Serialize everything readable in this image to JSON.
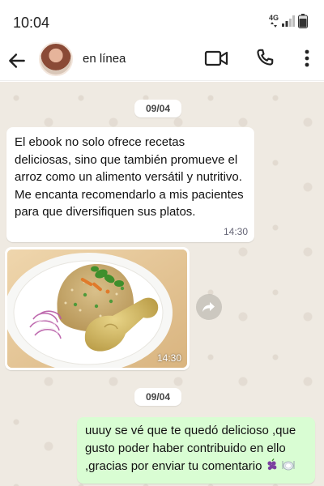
{
  "status_bar": {
    "time": "10:04",
    "network": "4G"
  },
  "header": {
    "contact_status": "en línea"
  },
  "chat": {
    "date_chips": [
      "09/04",
      "09/04"
    ],
    "incoming_message": {
      "text": "El ebook no solo ofrece recetas deliciosas, sino que también promueve el arroz como un alimento versátil y nutritivo. Me encanta recomendarlo a mis pacientes para que diversifiquen sus platos.",
      "time": "14:30"
    },
    "image_message": {
      "time": "14:30"
    },
    "outgoing_message": {
      "text": "uuuy se vé que te quedó delicioso ,que gusto poder haber contribuido en ello ,gracias por enviar tu comentario"
    }
  },
  "colors": {
    "chat_background": "#efeae2",
    "outgoing_bubble": "#d9fdd3",
    "incoming_bubble": "#ffffff"
  },
  "icons": {
    "back": "arrow-left-icon",
    "video": "video-call-icon",
    "phone": "phone-icon",
    "menu": "more-vert-icon",
    "forward": "forward-icon",
    "emojis": [
      "grape-icon",
      "plate-icon"
    ]
  }
}
